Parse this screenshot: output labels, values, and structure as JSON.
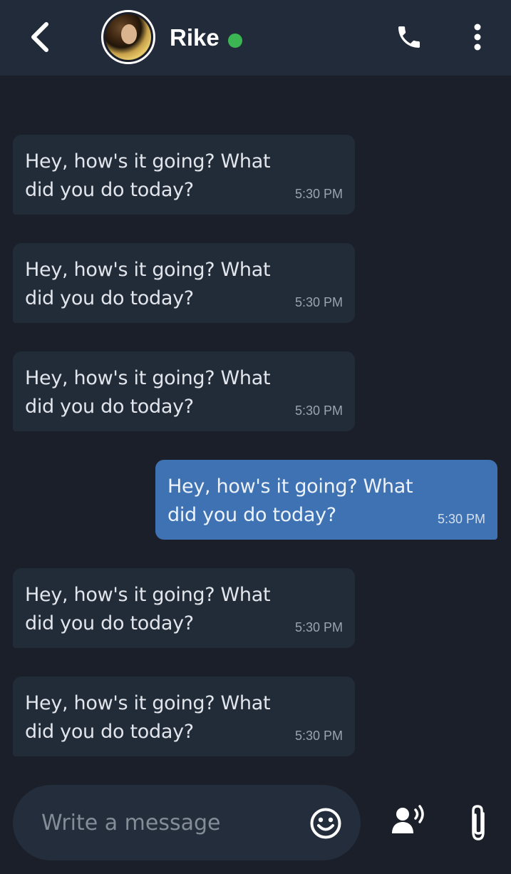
{
  "header": {
    "contact_name": "Rike",
    "status": "online",
    "status_color": "#3cb553",
    "icons": [
      "back-arrow-icon",
      "phone-icon",
      "more-vertical-icon"
    ]
  },
  "messages": [
    {
      "direction": "incoming",
      "text": "Hey, how's it going? What did you do today?",
      "time": "5:30 PM"
    },
    {
      "direction": "incoming",
      "text": "Hey, how's it going? What did you do today?",
      "time": "5:30 PM"
    },
    {
      "direction": "incoming",
      "text": "Hey, how's it going? What did you do today?",
      "time": "5:30 PM"
    },
    {
      "direction": "outgoing",
      "text": "Hey, how's it going? What did you do today?",
      "time": "5:30 PM"
    },
    {
      "direction": "incoming",
      "text": "Hey, how's it going? What did you do today?",
      "time": "5:30 PM"
    },
    {
      "direction": "incoming",
      "text": "Hey, how's it going? What did you do today?",
      "time": "5:30 PM"
    }
  ],
  "composer": {
    "placeholder": "Write a message",
    "value": "",
    "icons": [
      "emoji-icon",
      "voice-message-icon",
      "paperclip-icon"
    ]
  },
  "colors": {
    "background": "#1a1f2a",
    "header": "#212b39",
    "incoming_bubble": "#222b38",
    "outgoing_bubble": "#3f72b2"
  }
}
